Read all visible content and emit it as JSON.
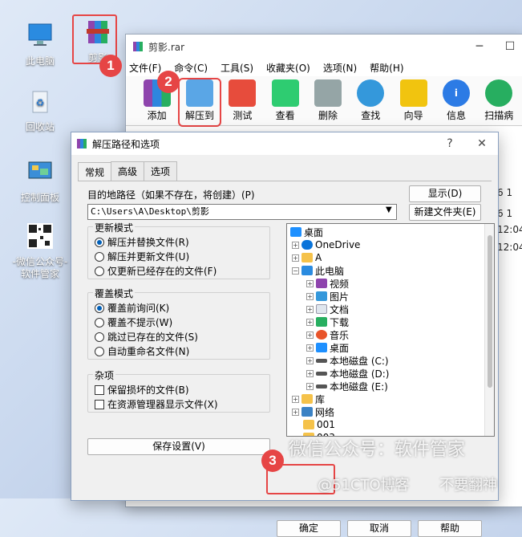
{
  "desktop": {
    "icons": [
      {
        "label": "此电脑"
      },
      {
        "label": "回收站"
      },
      {
        "label": "控制面板"
      },
      {
        "label": "-微信公众号-"
      },
      {
        "label": "软件管家"
      },
      {
        "label": "剪影"
      }
    ]
  },
  "rar": {
    "title": "剪影.rar",
    "menu": [
      "文件(F)",
      "命令(C)",
      "工具(S)",
      "收藏夹(O)",
      "选项(N)",
      "帮助(H)"
    ],
    "toolbar": [
      "添加",
      "解压到",
      "测试",
      "查看",
      "删除",
      "查找",
      "向导",
      "信息",
      "扫描病"
    ],
    "list_fragments": [
      "6 1",
      "6 1",
      "12:04",
      "12:04"
    ]
  },
  "dialog": {
    "title": "解压路径和选项",
    "help": "?",
    "close": "✕",
    "tabs": [
      "常规",
      "高级",
      "选项"
    ],
    "dest_label": "目的地路径（如果不存在，将创建）(P)",
    "dest_value": "C:\\Users\\A\\Desktop\\剪影",
    "show_button": "显示(D)",
    "new_folder_button": "新建文件夹(E)",
    "update_mode": {
      "title": "更新模式",
      "options": [
        "解压并替换文件(R)",
        "解压并更新文件(U)",
        "仅更新已经存在的文件(F)"
      ]
    },
    "overwrite_mode": {
      "title": "覆盖模式",
      "options": [
        "覆盖前询问(K)",
        "覆盖不提示(W)",
        "跳过已存在的文件(S)",
        "自动重命名文件(N)"
      ]
    },
    "misc": {
      "title": "杂项",
      "options": [
        "保留损坏的文件(B)",
        "在资源管理器显示文件(X)"
      ]
    },
    "save_button": "保存设置(V)",
    "tree": [
      "桌面",
      "OneDrive",
      "A",
      "此电脑",
      "视频",
      "图片",
      "文档",
      "下载",
      "音乐",
      "桌面",
      "本地磁盘 (C:)",
      "本地磁盘 (D:)",
      "本地磁盘 (E:)",
      "库",
      "网络",
      "001",
      "003"
    ],
    "ok_button": "确定",
    "cancel_button": "取消",
    "help_button": "帮助"
  },
  "markers": [
    "1",
    "2",
    "3"
  ],
  "watermarks": [
    "微信公众号：软件管家",
    "@51CTO博客",
    "不要翻神"
  ]
}
